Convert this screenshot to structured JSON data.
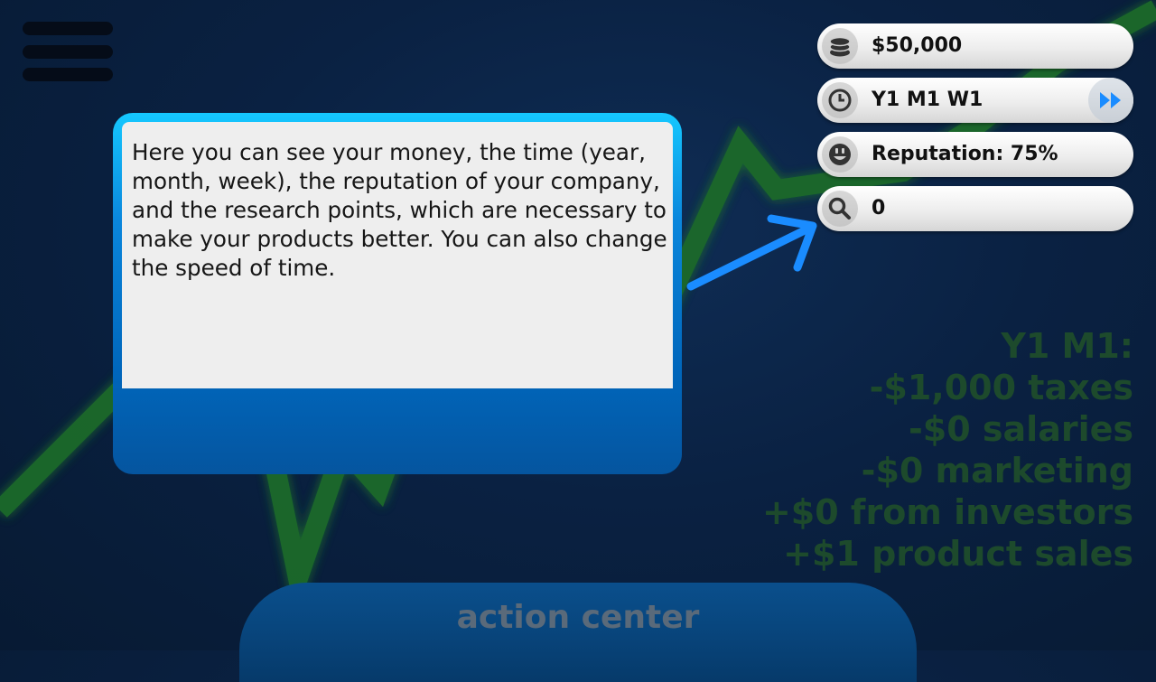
{
  "hud": {
    "money": "$50,000",
    "date": "Y1 M1 W1",
    "reputation": "Reputation: 75%",
    "research": "0",
    "icons": {
      "money": "coins-icon",
      "date": "clock-icon",
      "reputation": "smiley-icon",
      "research": "magnifier-icon",
      "speed": "fast-forward-icon",
      "menu": "hamburger-menu-icon"
    }
  },
  "tutorial": {
    "text": "Here you can see your money, the time (year, month, week), the reputation of your company, and the research points, which are necessary to make your products better. You can also change the speed of time."
  },
  "summary": {
    "lines": [
      "Y1 M1:",
      "-$1,000 taxes",
      "-$0 salaries",
      "-$0 marketing",
      "+$0 from investors",
      "+$1 product sales"
    ]
  },
  "action_center": {
    "label": "action center"
  },
  "colors": {
    "background": "#0a2142",
    "chart_line": "#1d6b2a",
    "dialog_accent": "#15c8ff",
    "arrow": "#1a8cff",
    "speed_icon": "#1a8cff"
  }
}
